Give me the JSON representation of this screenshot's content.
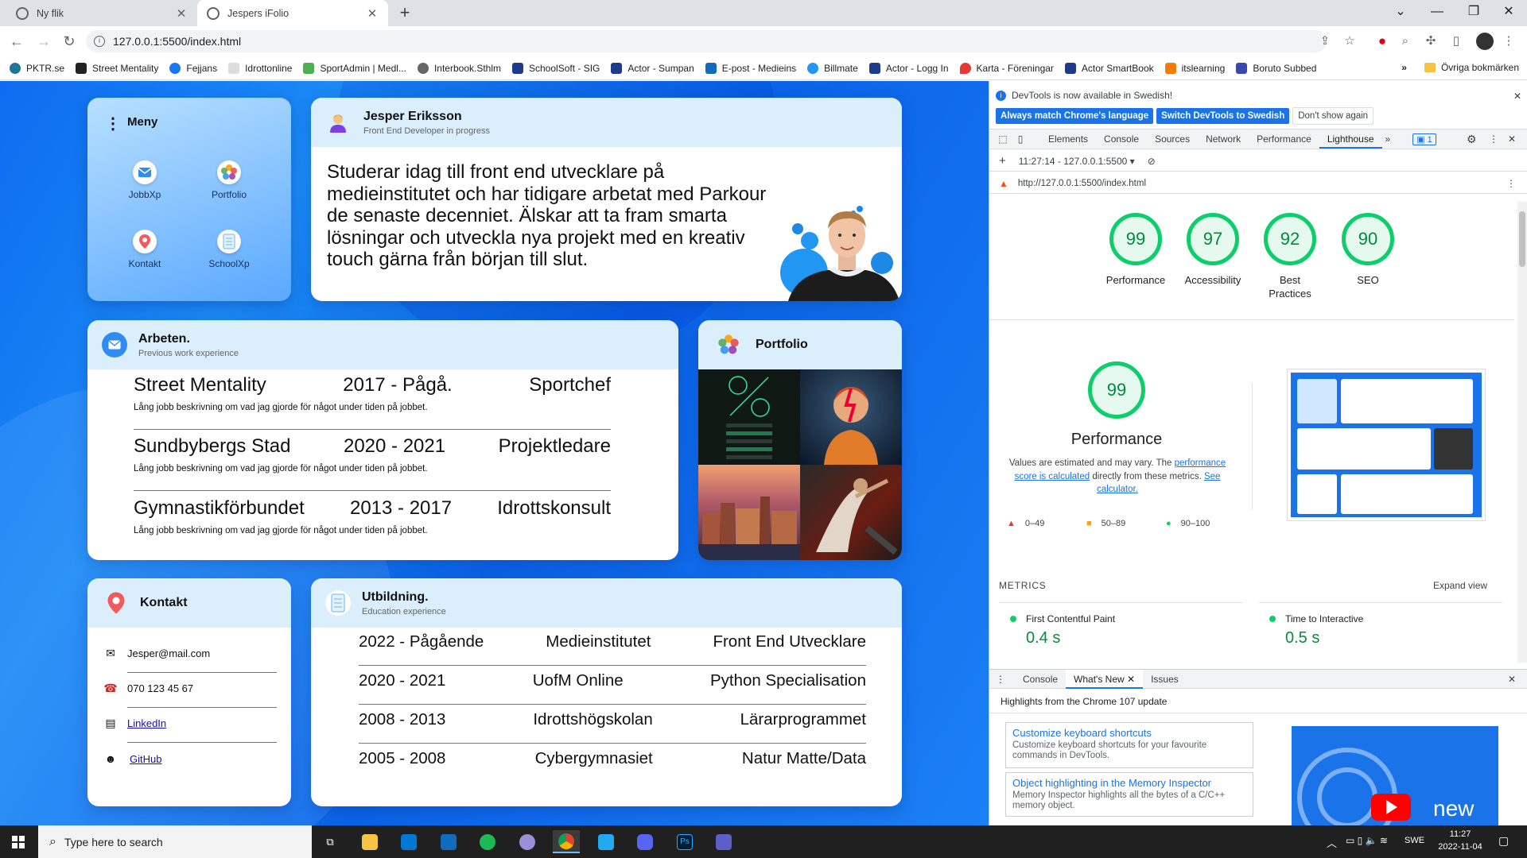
{
  "browser": {
    "tabs": [
      {
        "title": "Ny flik",
        "active": false
      },
      {
        "title": "Jespers iFolio",
        "active": true
      }
    ],
    "url": "127.0.0.1:5500/index.html",
    "bookmarks": [
      {
        "label": "PKTR.se",
        "color": "#21759b"
      },
      {
        "label": "Street Mentality",
        "color": "#222222"
      },
      {
        "label": "Fejjans",
        "color": "#1877f2"
      },
      {
        "label": "Idrottonline",
        "color": "#444444"
      },
      {
        "label": "SportAdmin | Medl...",
        "color": "#4caf50"
      },
      {
        "label": "Interbook.Sthlm",
        "color": "#555555"
      },
      {
        "label": "SchoolSoft - SIG",
        "color": "#1e3a8a"
      },
      {
        "label": "Actor - Sumpan",
        "color": "#1e3a8a"
      },
      {
        "label": "E-post - Medieins",
        "color": "#0f6cbd"
      },
      {
        "label": "Billmate",
        "color": "#2196f3"
      },
      {
        "label": "Actor - Logg In",
        "color": "#1e3a8a"
      },
      {
        "label": "Karta - Föreningar",
        "color": "#e53935"
      },
      {
        "label": "Actor SmartBook",
        "color": "#1e3a8a"
      },
      {
        "label": "itslearning",
        "color": "#f57c00"
      },
      {
        "label": "Boruto Subbed",
        "color": "#3949ab"
      }
    ],
    "bookmarks_more": "»",
    "other_bookmarks": "Övriga bokmärken"
  },
  "site": {
    "menu": {
      "title": "Meny",
      "items": [
        {
          "label": "JobbXp",
          "icon": "mail-icon"
        },
        {
          "label": "Portfolio",
          "icon": "photos-icon"
        },
        {
          "label": "Kontakt",
          "icon": "location-pin-icon"
        },
        {
          "label": "SchoolXp",
          "icon": "notebook-icon"
        }
      ]
    },
    "profile": {
      "name": "Jesper Eriksson",
      "subtitle": "Front End Developer in progress",
      "bio": "Studerar idag till front end utvecklare på medieinstitutet och har tidigare arbetat med Parkour de senaste decenniet. Älskar att ta fram smarta lösningar och utveckla nya projekt med en kreativ touch gärna från början till slut."
    },
    "work": {
      "title": "Arbeten.",
      "subtitle": "Previous work experience",
      "rows": [
        {
          "company": "Street Mentality",
          "years": "2017 - Pågå.",
          "role": "Sportchef",
          "desc": "Lång jobb beskrivning om vad jag gjorde för något under tiden på jobbet."
        },
        {
          "company": "Sundbybergs Stad",
          "years": "2020 - 2021",
          "role": "Projektledare",
          "desc": "Lång jobb beskrivning om vad jag gjorde för något under tiden på jobbet."
        },
        {
          "company": "Gymnastikförbundet",
          "years": "2013 - 2017",
          "role": "Idrottskonsult",
          "desc": "Lång jobb beskrivning om vad jag gjorde för något under tiden på jobbet."
        }
      ]
    },
    "portfolio": {
      "title": "Portfolio"
    },
    "contact": {
      "title": "Kontakt",
      "email": "Jesper@mail.com",
      "phone": "070 123 45 67",
      "linkedin": "LinkedIn",
      "github": "GitHub"
    },
    "education": {
      "title": "Utbildning.",
      "subtitle": "Education experience",
      "rows": [
        {
          "years": "2022 - Pågående",
          "school": "Medieinstitutet",
          "program": "Front End Utvecklare"
        },
        {
          "years": "2020 - 2021",
          "school": "UofM Online",
          "program": "Python Specialisation"
        },
        {
          "years": "2008 - 2013",
          "school": "Idrottshögskolan",
          "program": "Lärarprogrammet"
        },
        {
          "years": "2005 - 2008",
          "school": "Cybergymnasiet",
          "program": "Natur Matte/Data"
        }
      ]
    }
  },
  "devtools": {
    "notice": "DevTools is now available in Swedish!",
    "btn_match": "Always match Chrome's language",
    "btn_switch": "Switch DevTools to Swedish",
    "btn_dont": "Don't show again",
    "tabs": [
      "Elements",
      "Console",
      "Sources",
      "Network",
      "Performance",
      "Lighthouse"
    ],
    "active_tab": "Lighthouse",
    "issues_count": "1",
    "report_select": "11:27:14 - 127.0.0.1:5500",
    "report_url": "http://127.0.0.1:5500/index.html",
    "scores": [
      {
        "value": "99",
        "label": "Performance"
      },
      {
        "value": "97",
        "label": "Accessibility"
      },
      {
        "value": "92",
        "label": "Best Practices"
      },
      {
        "value": "90",
        "label": "SEO"
      }
    ],
    "big_score": "99",
    "big_label": "Performance",
    "note_pre": "Values are estimated and may vary. The ",
    "note_link1": "performance score is calculated",
    "note_mid": " directly from these metrics. ",
    "note_link2": "See calculator.",
    "legend": [
      "0–49",
      "50–89",
      "90–100"
    ],
    "metrics_title": "METRICS",
    "expand_view": "Expand view",
    "metrics": [
      {
        "name": "First Contentful Paint",
        "value": "0.4 s"
      },
      {
        "name": "Time to Interactive",
        "value": "0.5 s"
      }
    ],
    "drawer_tabs": [
      "Console",
      "What's New",
      "Issues"
    ],
    "drawer_heading": "Highlights from the Chrome 107 update",
    "tips": [
      {
        "title": "Customize keyboard shortcuts",
        "desc": "Customize keyboard shortcuts for your favourite commands in DevTools."
      },
      {
        "title": "Object highlighting in the Memory Inspector",
        "desc": "Memory Inspector highlights all the bytes of a C/C++ memory object."
      }
    ],
    "video_text": "new"
  },
  "taskbar": {
    "search_placeholder": "Type here to search",
    "lang": "SWE",
    "time": "11:27",
    "date": "2022-11-04"
  }
}
